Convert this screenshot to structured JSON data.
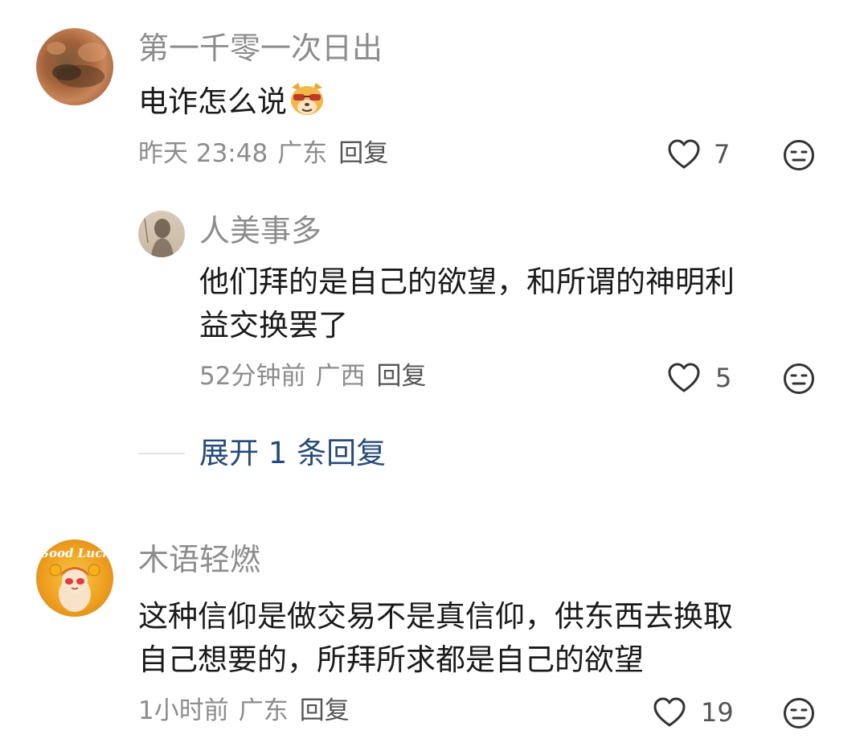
{
  "comments": [
    {
      "username": "第一千零一次日出",
      "text": "电诈怎么说",
      "emoji": "doge-sunglasses-emoji",
      "time": "昨天 23:48",
      "location": "广东",
      "reply_label": "回复",
      "likes": "7",
      "reply": {
        "username": "人美事多",
        "text_lines": [
          "他们拜的是自己的欲望，和所谓的神明利",
          "益交换罢了"
        ],
        "time": "52分钟前",
        "location": "广西",
        "reply_label": "回复",
        "likes": "5"
      },
      "expand_label": "展开 1 条回复"
    },
    {
      "username": "木语轻燃",
      "avatar_text": "Good Luck",
      "text_lines": [
        "这种信仰是做交易不是真信仰，供东西去换取",
        "自己想要的，所拜所求都是自己的欲望"
      ],
      "time": "1小时前",
      "location": "广东",
      "reply_label": "回复",
      "likes": "19"
    }
  ],
  "colors": {
    "username": "#8c8c8c",
    "content": "#1a1a1a",
    "meta": "#8c8c8c",
    "expand_link": "#274a7a"
  }
}
